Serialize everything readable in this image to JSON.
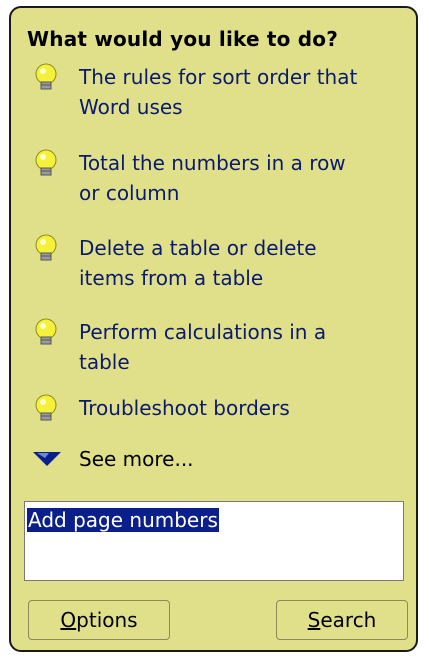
{
  "balloon": {
    "title": "What would you like to do?",
    "suggestions": [
      {
        "line1": "The rules for sort order that",
        "line2": "Word uses"
      },
      {
        "line1": "Total the numbers in a row",
        "line2": "or column"
      },
      {
        "line1": "Delete a table or delete",
        "line2": "items from a table"
      },
      {
        "line1": "Perform calculations in a",
        "line2": "table"
      },
      {
        "line1": "Troubleshoot borders",
        "line2": ""
      }
    ],
    "see_more": "See more...",
    "query_value": "Add page numbers",
    "buttons": {
      "options_mnemonic": "O",
      "options_rest": "ptions",
      "search_mnemonic": "S",
      "search_rest": "earch"
    }
  },
  "colors": {
    "balloon_bg": "#e0e08a",
    "link_text": "#0a1a6e",
    "selection_bg": "#0a1f8a",
    "bulb_yellow": "#f5f03a"
  },
  "icons": {
    "suggestion": "lightbulb-icon",
    "see_more": "triangle-down-icon"
  }
}
